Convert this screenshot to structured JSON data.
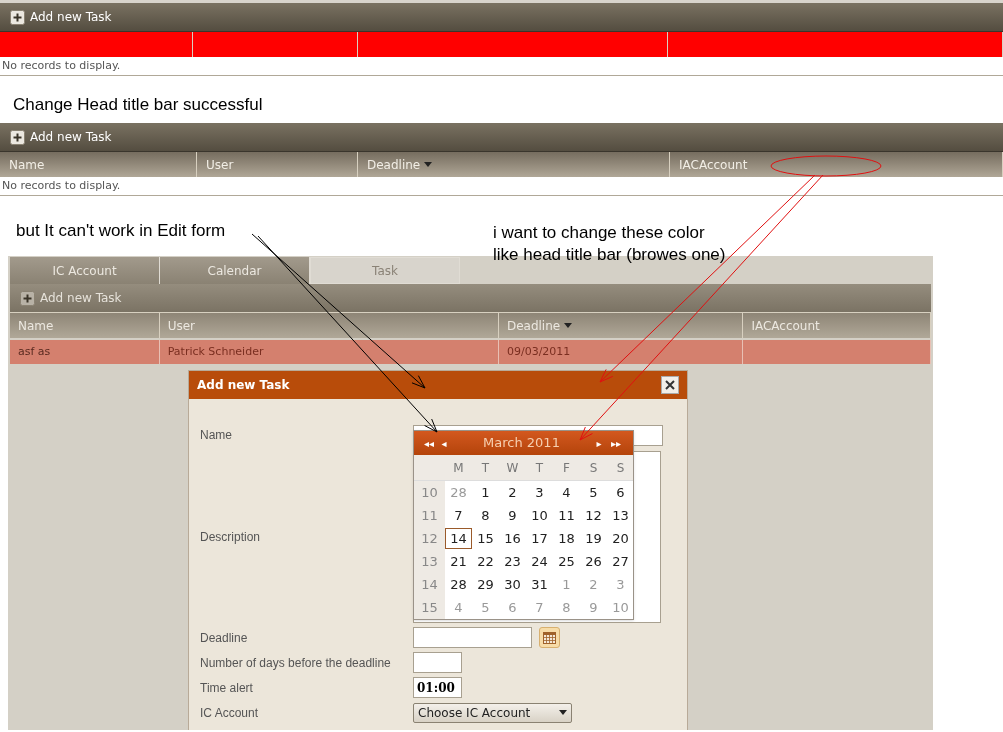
{
  "grids": [
    {
      "toolbar_button": "Add new Task",
      "kind": "red_header",
      "columns": [
        {
          "sorted": false
        },
        {
          "sorted": false
        },
        {
          "sorted": false
        },
        {
          "sorted": false
        }
      ],
      "empty_text": "No records to display."
    },
    {
      "toolbar_button": "Add new Task",
      "kind": "plain_header",
      "columns": [
        {
          "label": "Name",
          "sorted": false
        },
        {
          "label": "User",
          "sorted": false
        },
        {
          "label": "Deadline",
          "sorted": true
        },
        {
          "label": "IACAccount",
          "sorted": false
        }
      ],
      "empty_text": "No records to display."
    }
  ],
  "heading": "Change Head title bar successful",
  "annotations": [
    {
      "text": "but It can't work in Edit form"
    },
    {
      "text": "i want to change these color like head title bar (browes one)"
    }
  ],
  "app": {
    "tabs": [
      {
        "label": "IC Account",
        "selected": false
      },
      {
        "label": "Calendar",
        "selected": false
      },
      {
        "label": "Task",
        "selected": true
      }
    ],
    "toolbar_button": "Add new Task",
    "columns": [
      {
        "label": "Name",
        "sorted": false
      },
      {
        "label": "User",
        "sorted": false
      },
      {
        "label": "Deadline",
        "sorted": true
      },
      {
        "label": "IACAccount",
        "sorted": false
      }
    ],
    "rows": [
      {
        "cells": [
          "asf as",
          "Patrick Schneider",
          "09/03/2011",
          ""
        ],
        "selected": true
      }
    ],
    "dialog": {
      "title": "Add new Task",
      "fields": [
        {
          "label": "Name",
          "kind": "text"
        },
        {
          "label": "Description",
          "kind": "textarea"
        },
        {
          "label": "Deadline",
          "kind": "date"
        },
        {
          "label": "Number of days before the deadline",
          "kind": "short"
        },
        {
          "label": "Time alert",
          "kind": "short",
          "value": "01:00"
        },
        {
          "label": "IC Account",
          "kind": "select",
          "value": "Choose IC Account"
        }
      ],
      "calendar": {
        "title": "March 2011",
        "prev_year": "◂◂",
        "prev": "◂",
        "next": "▸",
        "next_year": "▸▸",
        "weekdays": [
          "M",
          "T",
          "W",
          "T",
          "F",
          "S",
          "S"
        ],
        "weeks": [
          {
            "number": "10",
            "days": [
              {
                "label": "28",
                "other_month": true,
                "selected": false
              },
              {
                "label": "1",
                "other_month": false,
                "selected": false
              },
              {
                "label": "2",
                "other_month": false,
                "selected": false
              },
              {
                "label": "3",
                "other_month": false,
                "selected": false
              },
              {
                "label": "4",
                "other_month": false,
                "selected": false
              },
              {
                "label": "5",
                "other_month": false,
                "selected": false
              },
              {
                "label": "6",
                "other_month": false,
                "selected": false
              }
            ]
          },
          {
            "number": "11",
            "days": [
              {
                "label": "7",
                "other_month": false,
                "selected": false
              },
              {
                "label": "8",
                "other_month": false,
                "selected": false
              },
              {
                "label": "9",
                "other_month": false,
                "selected": false
              },
              {
                "label": "10",
                "other_month": false,
                "selected": false
              },
              {
                "label": "11",
                "other_month": false,
                "selected": false
              },
              {
                "label": "12",
                "other_month": false,
                "selected": false
              },
              {
                "label": "13",
                "other_month": false,
                "selected": false
              }
            ]
          },
          {
            "number": "12",
            "days": [
              {
                "label": "14",
                "other_month": false,
                "selected": true
              },
              {
                "label": "15",
                "other_month": false,
                "selected": false
              },
              {
                "label": "16",
                "other_month": false,
                "selected": false
              },
              {
                "label": "17",
                "other_month": false,
                "selected": false
              },
              {
                "label": "18",
                "other_month": false,
                "selected": false
              },
              {
                "label": "19",
                "other_month": false,
                "selected": false
              },
              {
                "label": "20",
                "other_month": false,
                "selected": false
              }
            ]
          },
          {
            "number": "13",
            "days": [
              {
                "label": "21",
                "other_month": false,
                "selected": false
              },
              {
                "label": "22",
                "other_month": false,
                "selected": false
              },
              {
                "label": "23",
                "other_month": false,
                "selected": false
              },
              {
                "label": "24",
                "other_month": false,
                "selected": false
              },
              {
                "label": "25",
                "other_month": false,
                "selected": false
              },
              {
                "label": "26",
                "other_month": false,
                "selected": false
              },
              {
                "label": "27",
                "other_month": false,
                "selected": false
              }
            ]
          },
          {
            "number": "14",
            "days": [
              {
                "label": "28",
                "other_month": false,
                "selected": false
              },
              {
                "label": "29",
                "other_month": false,
                "selected": false
              },
              {
                "label": "30",
                "other_month": false,
                "selected": false
              },
              {
                "label": "31",
                "other_month": false,
                "selected": false
              },
              {
                "label": "1",
                "other_month": true,
                "selected": false
              },
              {
                "label": "2",
                "other_month": true,
                "selected": false
              },
              {
                "label": "3",
                "other_month": true,
                "selected": false
              }
            ]
          },
          {
            "number": "15",
            "days": [
              {
                "label": "4",
                "other_month": true,
                "selected": false
              },
              {
                "label": "5",
                "other_month": true,
                "selected": false
              },
              {
                "label": "6",
                "other_month": true,
                "selected": false
              },
              {
                "label": "7",
                "other_month": true,
                "selected": false
              },
              {
                "label": "8",
                "other_month": true,
                "selected": false
              },
              {
                "label": "9",
                "other_month": true,
                "selected": false
              },
              {
                "label": "10",
                "other_month": true,
                "selected": false
              }
            ]
          }
        ]
      }
    }
  }
}
